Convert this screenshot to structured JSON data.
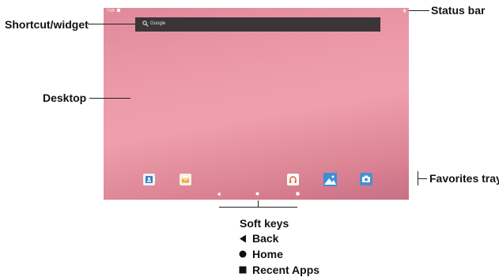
{
  "callouts": {
    "status_bar": "Status bar",
    "shortcut_widget": "Shortcut/widget",
    "desktop": "Desktop",
    "favorites_tray": "Favorites tray",
    "soft_keys": "Soft keys",
    "back": "Back",
    "home": "Home",
    "recent_apps": "Recent Apps"
  },
  "screen": {
    "status_time": "7:55",
    "status_right": "◦ ▮",
    "search_placeholder": "Google"
  },
  "colors": {
    "wallpaper": "#ec9aa9",
    "search_bar": "#3b3538"
  },
  "icons": {
    "tray": [
      "contacts-icon",
      "email-icon",
      "music-icon",
      "gallery-icon",
      "camera-icon"
    ],
    "softkeys": [
      "back-icon",
      "home-icon",
      "recent-apps-icon"
    ]
  }
}
